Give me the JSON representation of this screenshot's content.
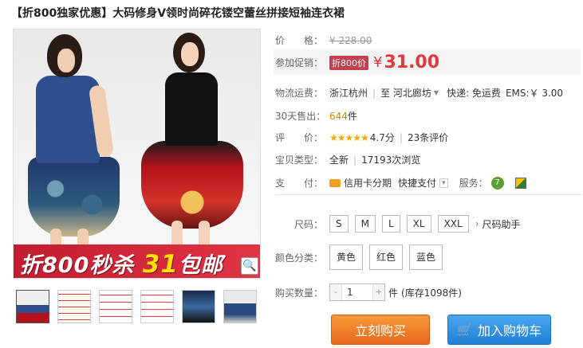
{
  "title": "【折800独家优惠】大码修身V领时尚碎花镂空蕾丝拼接短袖连衣裙",
  "banner": {
    "prefix": "折800秒杀",
    "number": "31",
    "suffix": "包邮"
  },
  "info": {
    "price_label": "价　　格：",
    "original_price": "¥ 228.00",
    "promo_label": "参加促销：",
    "promo_tag": "折800价",
    "currency": "¥",
    "promo_price": "31.00",
    "shipping_label": "物流运费：",
    "ship_from": "浙江杭州",
    "ship_to_prefix": "至",
    "ship_to": "河北廊坊",
    "ship_express": "快递: 免运费",
    "ship_ems": "EMS:￥ 3.00",
    "sold_label": "30天售出：",
    "sold_count": "644",
    "sold_unit": "件",
    "rating_label": "评　　价：",
    "stars": "★★★★★",
    "rating_score": "4.7分",
    "review_count": "23条评价",
    "type_label": "宝贝类型：",
    "type_value": "全新",
    "views": "17193次浏览",
    "payment_label": "支　　付：",
    "pay_credit": "信用卡分期",
    "pay_quick": "快捷支付",
    "service_label": "服务：",
    "service_icon_1": "7"
  },
  "options": {
    "size_label": "尺码：",
    "sizes": [
      "S",
      "M",
      "L",
      "XL",
      "XXL"
    ],
    "size_guide": "尺码助手",
    "color_label": "颜色分类：",
    "colors": [
      "黄色",
      "红色",
      "蓝色"
    ],
    "qty_label": "购买数量：",
    "qty_minus": "-",
    "qty_plus": "+",
    "qty_value": "1",
    "qty_unit": "件",
    "stock": "(库存1098件)"
  },
  "actions": {
    "buy": "立刻购买",
    "cart": "加入购物车"
  },
  "icons": {
    "zoom": "magnifier-icon",
    "cart": "shopping-cart-icon",
    "size_guide": "chevron-right-icon"
  }
}
